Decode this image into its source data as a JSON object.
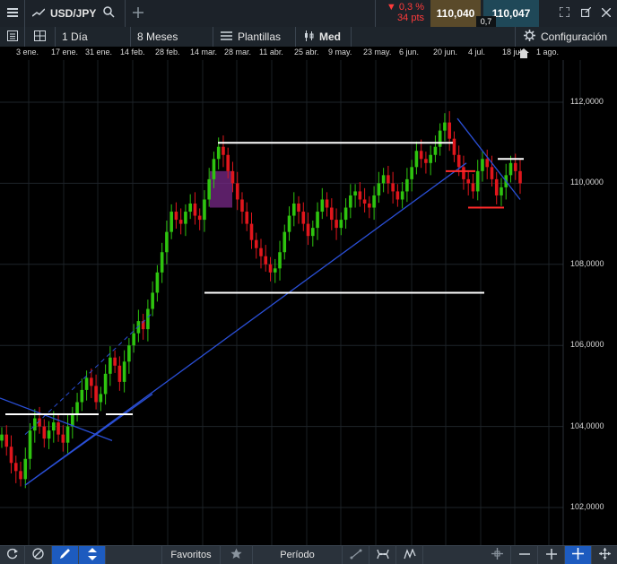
{
  "colors": {
    "up": "#2ec40f",
    "down": "#e0161c",
    "trendline": "#2a4fd6",
    "level": "#ffffff",
    "redline": "#ff2a2a",
    "highlight": "#7a2a8a"
  },
  "header": {
    "menu_icon": "hamburger-icon",
    "symbol": "USD/JPY",
    "search_icon": "search-icon",
    "add_icon": "plus-icon",
    "change_pct": "▼ 0,3 %",
    "change_pts": "34 pts",
    "bid": "110,040",
    "spread": "0,7",
    "ask": "110,047",
    "window_icons": [
      "expand-icon",
      "popout-icon",
      "close-icon"
    ]
  },
  "toolbar": {
    "interval": "1 Día",
    "range": "8 Meses",
    "templates": "Plantillas",
    "price_type": "Med",
    "settings": "Configuración"
  },
  "x_ticks": [
    "3 ene.",
    "17 ene.",
    "31 ene.",
    "14 feb.",
    "28 feb.",
    "14 mar.",
    "28 mar.",
    "11 abr.",
    "25 abr.",
    "9 may.",
    "23 may.",
    "6 jun.",
    "20 jun.",
    "4 jul.",
    "18 jul.",
    "1 ago."
  ],
  "y_ticks": [
    "112,0000",
    "110,0000",
    "108,0000",
    "106,0000",
    "104,0000",
    "102,0000"
  ],
  "bottom": {
    "favorites": "Favoritos",
    "period": "Período"
  },
  "chart_data": {
    "type": "candlestick",
    "ylim": [
      101.0,
      113.0
    ],
    "y_ticks": [
      112,
      110,
      108,
      106,
      104,
      102
    ],
    "closes": [
      103.8,
      103.5,
      103.1,
      102.9,
      102.7,
      103.2,
      103.9,
      104.2,
      104.0,
      103.7,
      103.9,
      104.1,
      103.8,
      103.6,
      104.0,
      104.3,
      104.6,
      104.9,
      105.2,
      105.0,
      104.6,
      104.8,
      105.3,
      105.7,
      105.5,
      105.1,
      105.6,
      106.0,
      106.3,
      106.6,
      106.4,
      106.9,
      107.3,
      107.8,
      108.3,
      108.8,
      109.3,
      109.1,
      109.0,
      109.3,
      109.5,
      109.2,
      109.1,
      109.6,
      110.1,
      110.6,
      110.9,
      110.7,
      110.3,
      110.0,
      109.6,
      109.3,
      109.0,
      108.6,
      108.4,
      108.2,
      108.0,
      107.8,
      107.9,
      108.3,
      108.8,
      109.2,
      109.5,
      109.3,
      109.0,
      108.7,
      108.9,
      109.3,
      109.6,
      109.4,
      109.1,
      108.9,
      109.1,
      109.4,
      109.7,
      109.8,
      109.6,
      109.5,
      109.4,
      109.7,
      110.0,
      110.2,
      110.0,
      109.8,
      109.6,
      109.8,
      110.1,
      110.4,
      110.8,
      110.6,
      110.5,
      110.7,
      110.9,
      111.3,
      111.5,
      111.1,
      110.7,
      110.4,
      110.1,
      110.0,
      109.8,
      110.3,
      110.6,
      110.4,
      110.1,
      109.7,
      109.9,
      110.2,
      110.5,
      110.3,
      110.0
    ],
    "levels": [
      111.0,
      110.6,
      107.3,
      104.3,
      104.3
    ],
    "red_levels": [
      110.3,
      109.4
    ]
  }
}
